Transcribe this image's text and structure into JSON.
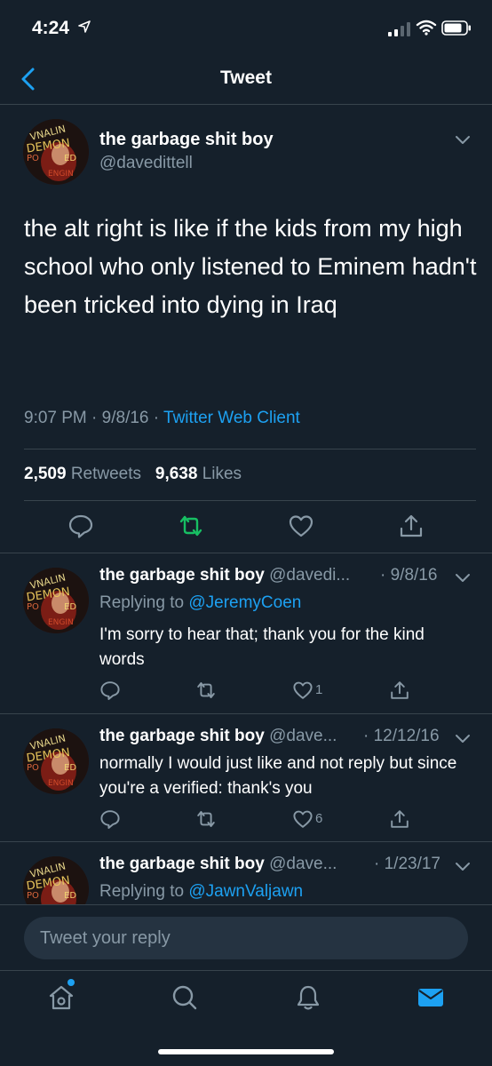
{
  "status_bar": {
    "time": "4:24",
    "icons": [
      "location-arrow-icon",
      "cellular-signal-icon",
      "wifi-icon",
      "battery-icon"
    ]
  },
  "nav": {
    "title": "Tweet",
    "back_icon": "chevron-left-icon"
  },
  "main_tweet": {
    "display_name": "the garbage shit boy",
    "handle": "@davedittell",
    "text": "the alt right is like if the kids from my high school who only listened to Eminem hadn't been tricked into dying in Iraq",
    "time": "9:07 PM",
    "date": "9/8/16",
    "client": "Twitter Web Client",
    "retweets_count": "2,509",
    "retweets_label": "Retweets",
    "likes_count": "9,638",
    "likes_label": "Likes",
    "actions": [
      "reply-icon",
      "retweet-icon",
      "like-icon",
      "share-icon"
    ],
    "retweet_active_color": "#17bf63"
  },
  "replies": [
    {
      "display_name": "the garbage shit boy",
      "handle": "@davedi...",
      "date": "· 9/8/16",
      "replying_prefix": "Replying to",
      "replying_to": "@JeremyCoen",
      "text": "I'm sorry to hear that; thank you for the kind words",
      "like_count": "1"
    },
    {
      "display_name": "the garbage shit boy",
      "handle": "@dave...",
      "date": "· 12/12/16",
      "text": "normally I would just like and not reply but since you're a verified: thank's you",
      "like_count": "6"
    },
    {
      "display_name": "the garbage shit boy",
      "handle": "@dave...",
      "date": "· 1/23/17",
      "replying_prefix": "Replying to",
      "replying_to": "@JawnValjawn"
    }
  ],
  "composer": {
    "placeholder": "Tweet your reply"
  },
  "tab_bar": {
    "tabs": [
      "home-icon",
      "search-icon",
      "notifications-icon",
      "messages-icon"
    ],
    "active_tab": "messages-icon"
  },
  "colors": {
    "background": "#15202b",
    "accent": "#1da1f2",
    "secondary_text": "#8899a6",
    "divider": "#38444d"
  }
}
